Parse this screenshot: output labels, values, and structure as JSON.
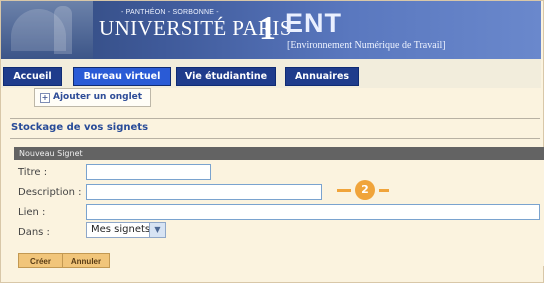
{
  "banner": {
    "small_text": "- PANTHÉON - SORBONNE -",
    "university": "UNIVERSITÉ PARIS",
    "number": "1",
    "ent_title": "ENT",
    "ent_subtitle": "[Environnement Numérique de Travail]"
  },
  "tabs": [
    {
      "label": "Accueil"
    },
    {
      "label": "Bureau virtuel"
    },
    {
      "label": "Vie étudiantine"
    },
    {
      "label": "Annuaires"
    }
  ],
  "add_tab_label": "Ajouter un onglet",
  "section_title": "Stockage de vos signets",
  "panel_title": "Nouveau Signet",
  "form": {
    "title_label": "Titre :",
    "description_label": "Description :",
    "link_label": "Lien :",
    "folder_label": "Dans :",
    "title_value": "",
    "description_value": "",
    "link_value": "",
    "folder_value": "Mes signets"
  },
  "actions": {
    "create": "Créer",
    "cancel": "Annuler"
  },
  "badge": "2",
  "colors": {
    "navy": "#1f3c8c",
    "orange": "#f0a43b"
  }
}
